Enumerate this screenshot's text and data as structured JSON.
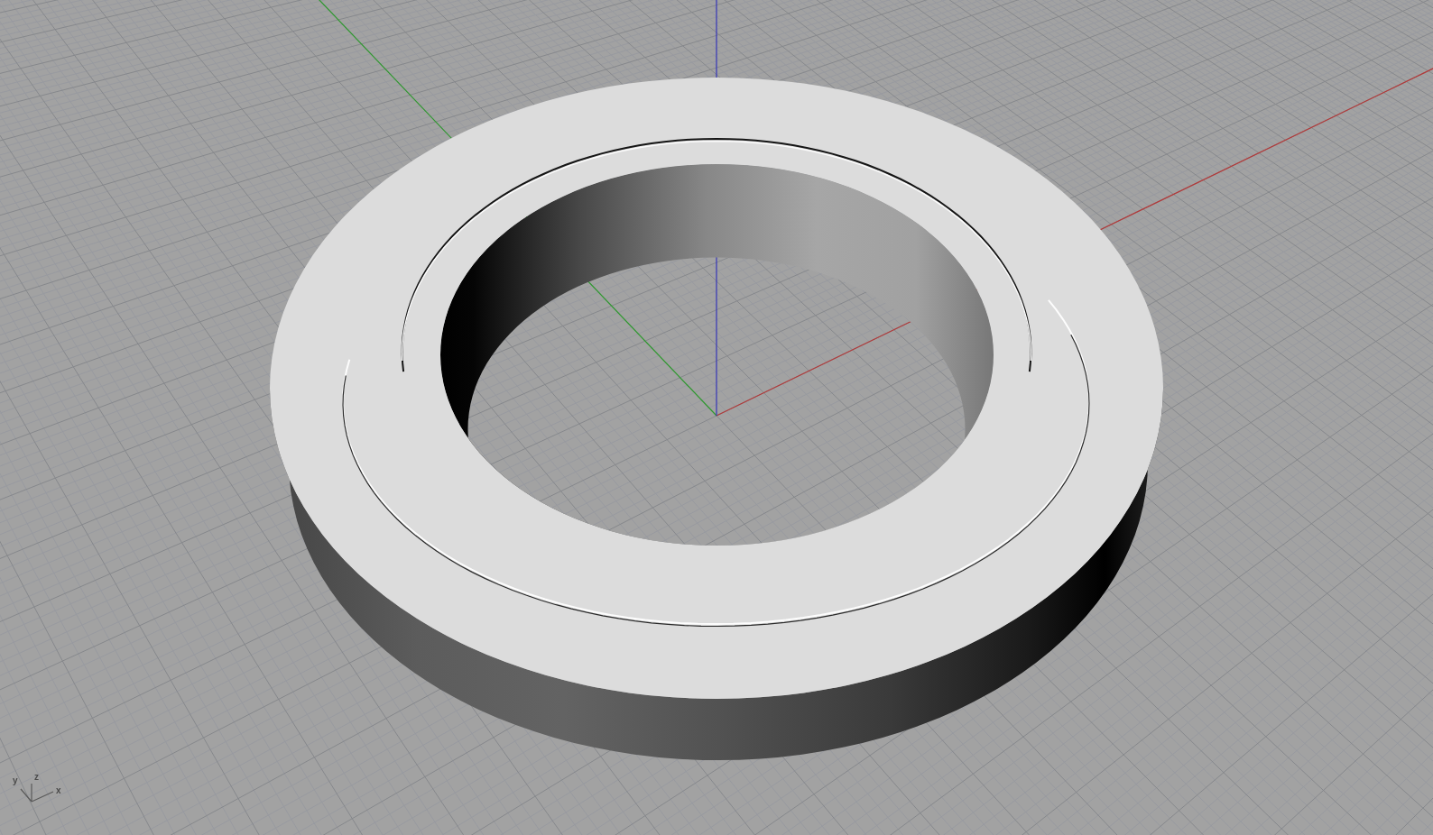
{
  "viewport": {
    "axis_indicator": {
      "labels": [
        "y",
        "z",
        "x"
      ]
    }
  }
}
